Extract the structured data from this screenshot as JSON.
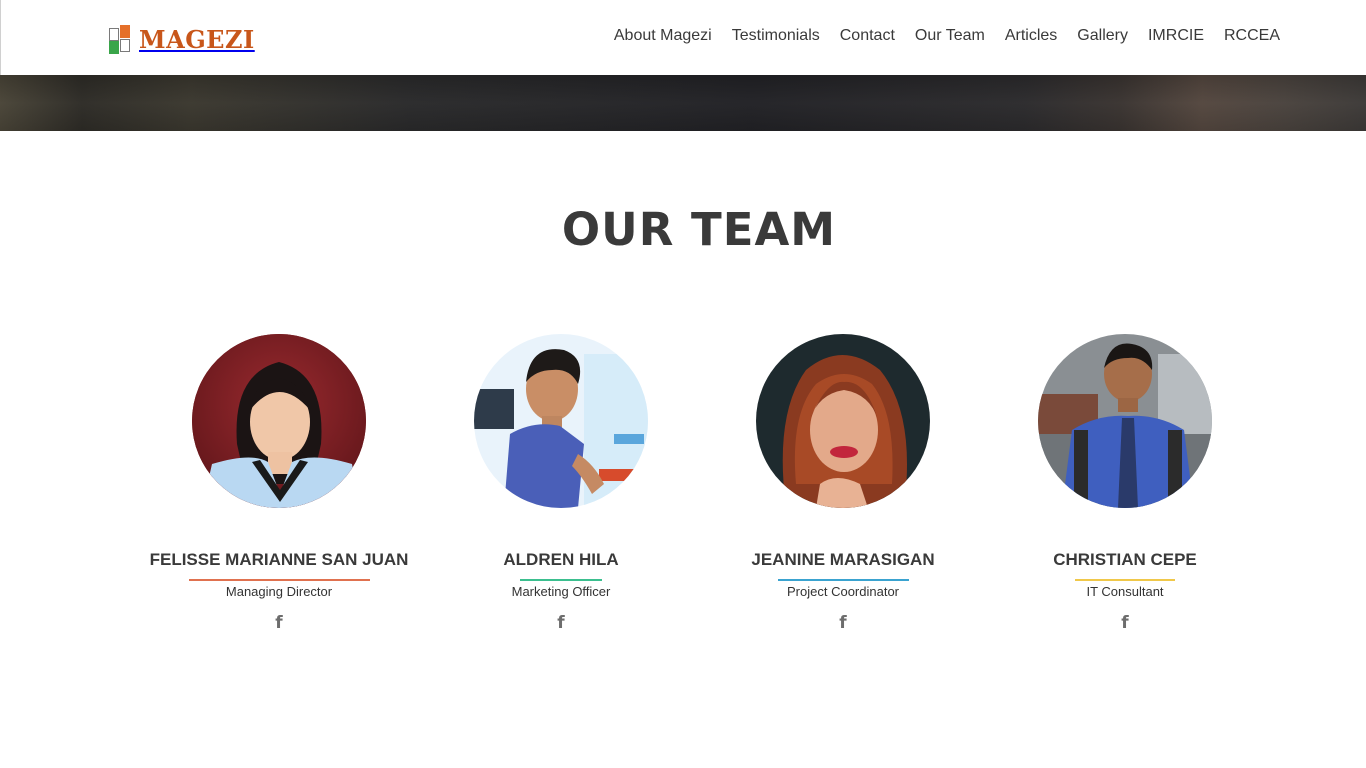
{
  "brand": {
    "name": "MAGEZI",
    "colors": {
      "logo_text": "#c8561a",
      "square_orange": "#e5702a",
      "square_green": "#3aa54a"
    }
  },
  "nav": {
    "items": [
      "About Magezi",
      "Testimonials",
      "Contact",
      "Our Team",
      "Articles",
      "Gallery",
      "IMRCIE",
      "RCCEA"
    ]
  },
  "section": {
    "title": "OUR TEAM"
  },
  "team": [
    {
      "name": "FELISSE MARIANNE SAN JUAN",
      "role": "Managing Director",
      "accent": "#e0714f",
      "social_icon": "facebook-icon",
      "social_glyph": "f"
    },
    {
      "name": "ALDREN HILA",
      "role": "Marketing Officer",
      "accent": "#3bbf8f",
      "social_icon": "facebook-icon",
      "social_glyph": "f"
    },
    {
      "name": "JEANINE MARASIGAN",
      "role": "Project Coordinator",
      "accent": "#3aa3d0",
      "social_icon": "facebook-icon",
      "social_glyph": "f"
    },
    {
      "name": "CHRISTIAN CEPE",
      "role": "IT Consultant",
      "accent": "#f0c84a",
      "social_icon": "facebook-icon",
      "social_glyph": "f"
    }
  ]
}
